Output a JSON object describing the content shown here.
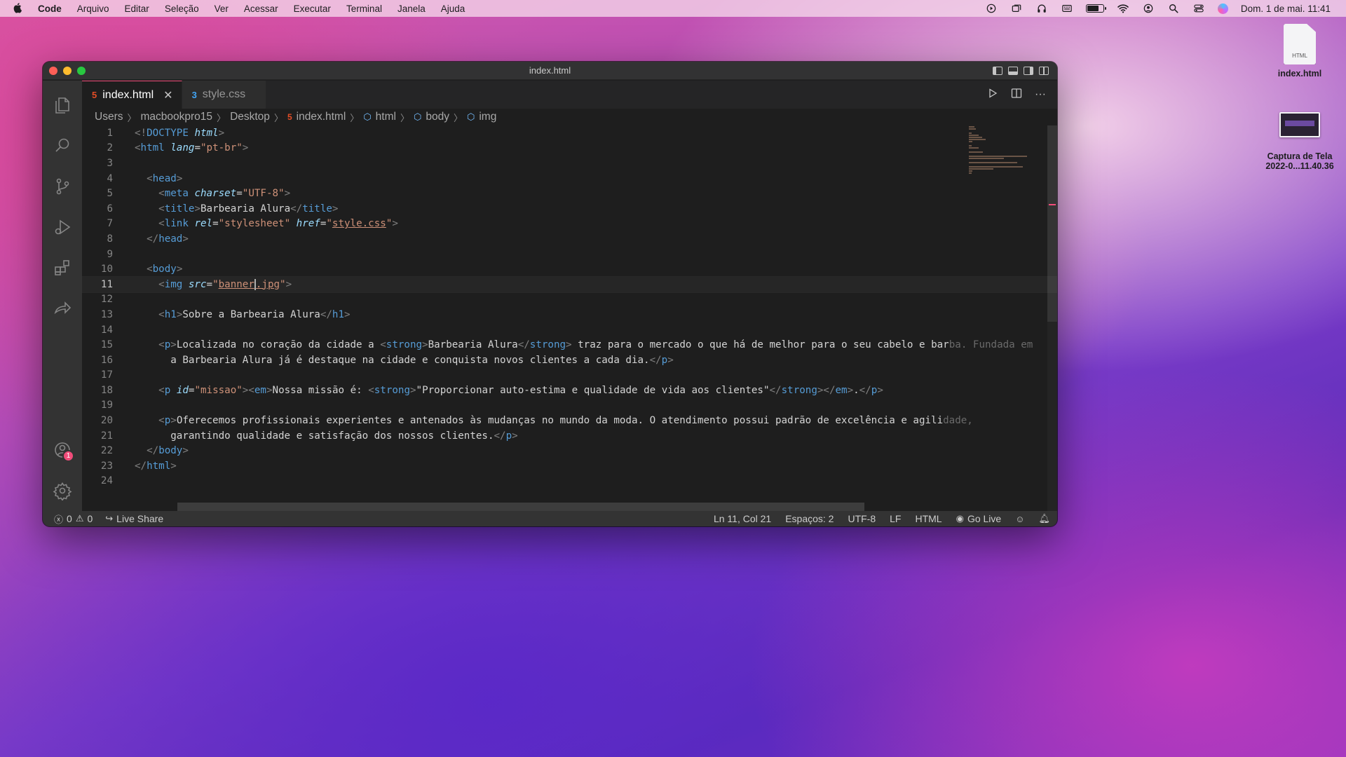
{
  "menubar": {
    "apple": "",
    "items": [
      "Code",
      "Arquivo",
      "Editar",
      "Seleção",
      "Ver",
      "Acessar",
      "Executar",
      "Terminal",
      "Janela",
      "Ajuda"
    ],
    "clock": "Dom. 1 de mai.  11:41",
    "battery_fraction": 0.75
  },
  "desktop": {
    "file_label": "index.html",
    "file_tag": "HTML",
    "screenshot_label_line1": "Captura de Tela",
    "screenshot_label_line2": "2022-0...11.40.36"
  },
  "window": {
    "title": "index.html",
    "tabs": [
      {
        "label": "index.html",
        "icon": "html5-icon",
        "active": true
      },
      {
        "label": "style.css",
        "icon": "css3-icon",
        "active": false
      }
    ],
    "tab_close": "✕",
    "breadcrumb": {
      "users": "Users",
      "user": "macbookpro15",
      "desktop": "Desktop",
      "file": "index.html",
      "html": "html",
      "body": "body",
      "img": "img"
    },
    "activity_badge": "1"
  },
  "editor": {
    "accent_color": "#f14c7a",
    "lines": [
      {
        "n": "1",
        "tokens": [
          [
            "tag",
            "<!"
          ],
          [
            "doc",
            "DOCTYPE "
          ],
          [
            "attr",
            "html"
          ],
          [
            "tag",
            ">"
          ]
        ]
      },
      {
        "n": "2",
        "tokens": [
          [
            "tag",
            "<"
          ],
          [
            "name",
            "html "
          ],
          [
            "attr",
            "lang"
          ],
          [
            "text",
            "="
          ],
          [
            "str",
            "\"pt-br\""
          ],
          [
            "tag",
            ">"
          ]
        ]
      },
      {
        "n": "3",
        "tokens": []
      },
      {
        "n": "4",
        "tokens": [
          [
            "text",
            "  "
          ],
          [
            "tag",
            "<"
          ],
          [
            "name",
            "head"
          ],
          [
            "tag",
            ">"
          ]
        ]
      },
      {
        "n": "5",
        "tokens": [
          [
            "text",
            "    "
          ],
          [
            "tag",
            "<"
          ],
          [
            "name",
            "meta "
          ],
          [
            "attr",
            "charset"
          ],
          [
            "text",
            "="
          ],
          [
            "str",
            "\"UTF-8\""
          ],
          [
            "tag",
            ">"
          ]
        ]
      },
      {
        "n": "6",
        "tokens": [
          [
            "text",
            "    "
          ],
          [
            "tag",
            "<"
          ],
          [
            "name",
            "title"
          ],
          [
            "tag",
            ">"
          ],
          [
            "text",
            "Barbearia Alura"
          ],
          [
            "tag",
            "</"
          ],
          [
            "name",
            "title"
          ],
          [
            "tag",
            ">"
          ]
        ]
      },
      {
        "n": "7",
        "tokens": [
          [
            "text",
            "    "
          ],
          [
            "tag",
            "<"
          ],
          [
            "name",
            "link "
          ],
          [
            "attr",
            "rel"
          ],
          [
            "text",
            "="
          ],
          [
            "str",
            "\"stylesheet\" "
          ],
          [
            "attr",
            "href"
          ],
          [
            "text",
            "="
          ],
          [
            "str",
            "\""
          ],
          [
            "strlink",
            "style.css"
          ],
          [
            "str",
            "\""
          ],
          [
            "tag",
            ">"
          ]
        ]
      },
      {
        "n": "8",
        "tokens": [
          [
            "text",
            "  "
          ],
          [
            "tag",
            "</"
          ],
          [
            "name",
            "head"
          ],
          [
            "tag",
            ">"
          ]
        ]
      },
      {
        "n": "9",
        "tokens": []
      },
      {
        "n": "10",
        "tokens": [
          [
            "text",
            "  "
          ],
          [
            "tag",
            "<"
          ],
          [
            "name",
            "body"
          ],
          [
            "tag",
            ">"
          ]
        ]
      },
      {
        "n": "11",
        "current": true,
        "tokens": [
          [
            "text",
            "    "
          ],
          [
            "tag",
            "<"
          ],
          [
            "name",
            "img "
          ],
          [
            "attr",
            "src"
          ],
          [
            "text",
            "="
          ],
          [
            "str",
            "\""
          ],
          [
            "strlink",
            "banner"
          ],
          [
            "cursor",
            ""
          ],
          [
            "strlink",
            ".jpg"
          ],
          [
            "str",
            "\""
          ],
          [
            "tag",
            ">"
          ]
        ]
      },
      {
        "n": "12",
        "tokens": []
      },
      {
        "n": "13",
        "tokens": [
          [
            "text",
            "    "
          ],
          [
            "tag",
            "<"
          ],
          [
            "name",
            "h1"
          ],
          [
            "tag",
            ">"
          ],
          [
            "text",
            "Sobre a Barbearia Alura"
          ],
          [
            "tag",
            "</"
          ],
          [
            "name",
            "h1"
          ],
          [
            "tag",
            ">"
          ]
        ]
      },
      {
        "n": "14",
        "tokens": []
      },
      {
        "n": "15",
        "tokens": [
          [
            "text",
            "    "
          ],
          [
            "tag",
            "<"
          ],
          [
            "name",
            "p"
          ],
          [
            "tag",
            ">"
          ],
          [
            "text",
            "Localizada no coração da cidade a "
          ],
          [
            "tag",
            "<"
          ],
          [
            "name",
            "strong"
          ],
          [
            "tag",
            ">"
          ],
          [
            "text",
            "Barbearia Alura"
          ],
          [
            "tag",
            "</"
          ],
          [
            "name",
            "strong"
          ],
          [
            "tag",
            "> "
          ],
          [
            "text",
            "traz para o mercado o que há de melhor para o seu cabelo e bar"
          ],
          [
            "dim",
            "ba. Fundada em"
          ]
        ]
      },
      {
        "n": "16",
        "tokens": [
          [
            "text",
            "      a Barbearia Alura já é destaque na cidade e conquista novos clientes a cada dia."
          ],
          [
            "tag",
            "</"
          ],
          [
            "name",
            "p"
          ],
          [
            "tag",
            ">"
          ]
        ]
      },
      {
        "n": "17",
        "tokens": []
      },
      {
        "n": "18",
        "tokens": [
          [
            "text",
            "    "
          ],
          [
            "tag",
            "<"
          ],
          [
            "name",
            "p "
          ],
          [
            "attr",
            "id"
          ],
          [
            "text",
            "="
          ],
          [
            "str",
            "\"missao\""
          ],
          [
            "tag",
            "><"
          ],
          [
            "name",
            "em"
          ],
          [
            "tag",
            ">"
          ],
          [
            "text",
            "Nossa missão é: "
          ],
          [
            "tag",
            "<"
          ],
          [
            "name",
            "strong"
          ],
          [
            "tag",
            ">"
          ],
          [
            "text",
            "\"Proporcionar auto-estima e qualidade de vida aos clientes\""
          ],
          [
            "tag",
            "</"
          ],
          [
            "name",
            "strong"
          ],
          [
            "tag",
            "></"
          ],
          [
            "name",
            "em"
          ],
          [
            "tag",
            ">"
          ],
          [
            "text",
            "."
          ],
          [
            "tag",
            "</"
          ],
          [
            "name",
            "p"
          ],
          [
            "tag",
            ">"
          ]
        ]
      },
      {
        "n": "19",
        "tokens": []
      },
      {
        "n": "20",
        "tokens": [
          [
            "text",
            "    "
          ],
          [
            "tag",
            "<"
          ],
          [
            "name",
            "p"
          ],
          [
            "tag",
            ">"
          ],
          [
            "text",
            "Oferecemos profissionais experientes e antenados às mudanças no mundo da moda. O atendimento possui padrão de excelência e agili"
          ],
          [
            "dim",
            "dade,"
          ]
        ]
      },
      {
        "n": "21",
        "tokens": [
          [
            "text",
            "      garantindo qualidade e satisfação dos nossos clientes."
          ],
          [
            "tag",
            "</"
          ],
          [
            "name",
            "p"
          ],
          [
            "tag",
            ">"
          ]
        ]
      },
      {
        "n": "22",
        "tokens": [
          [
            "text",
            "  "
          ],
          [
            "tag",
            "</"
          ],
          [
            "name",
            "body"
          ],
          [
            "tag",
            ">"
          ]
        ]
      },
      {
        "n": "23",
        "tokens": [
          [
            "tag",
            "</"
          ],
          [
            "name",
            "html"
          ],
          [
            "tag",
            ">"
          ]
        ]
      },
      {
        "n": "24",
        "tokens": []
      }
    ]
  },
  "statusbar": {
    "errors": "0",
    "warnings": "0",
    "live_share": "Live Share",
    "position": "Ln 11, Col 21",
    "spaces": "Espaços: 2",
    "encoding": "UTF-8",
    "eol": "LF",
    "language": "HTML",
    "go_live": "Go Live"
  }
}
